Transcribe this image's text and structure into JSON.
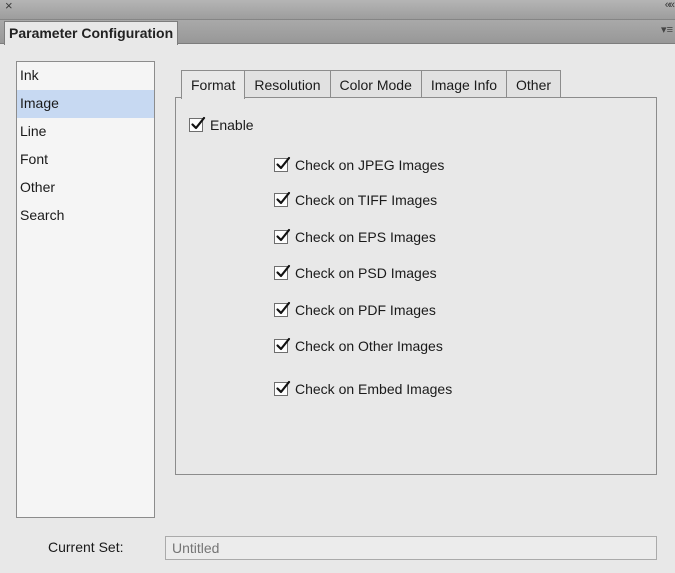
{
  "window": {
    "close_glyph": "×",
    "collapse_glyph": "««"
  },
  "panel": {
    "title": "Parameter Configuration",
    "menu_glyph": "▾≡"
  },
  "categories": [
    {
      "label": "Ink",
      "selected": false
    },
    {
      "label": "Image",
      "selected": true
    },
    {
      "label": "Line",
      "selected": false
    },
    {
      "label": "Font",
      "selected": false
    },
    {
      "label": "Other",
      "selected": false
    },
    {
      "label": "Search",
      "selected": false
    }
  ],
  "tabs": [
    {
      "label": "Format",
      "active": true
    },
    {
      "label": "Resolution",
      "active": false
    },
    {
      "label": "Color Mode",
      "active": false
    },
    {
      "label": "Image Info",
      "active": false
    },
    {
      "label": "Other",
      "active": false
    }
  ],
  "format": {
    "enable": {
      "label": "Enable",
      "checked": true
    },
    "checks": [
      {
        "label": "Check on JPEG Images",
        "checked": true
      },
      {
        "label": "Check on TIFF Images",
        "checked": true
      },
      {
        "label": "Check on EPS Images",
        "checked": true
      },
      {
        "label": "Check on PSD Images",
        "checked": true
      },
      {
        "label": "Check on PDF Images",
        "checked": true
      },
      {
        "label": "Check on Other Images",
        "checked": true
      },
      {
        "label": "Check on Embed Images",
        "checked": true
      }
    ]
  },
  "footer": {
    "current_set_label": "Current Set:",
    "current_set_value": "",
    "current_set_placeholder": "Untitled"
  }
}
